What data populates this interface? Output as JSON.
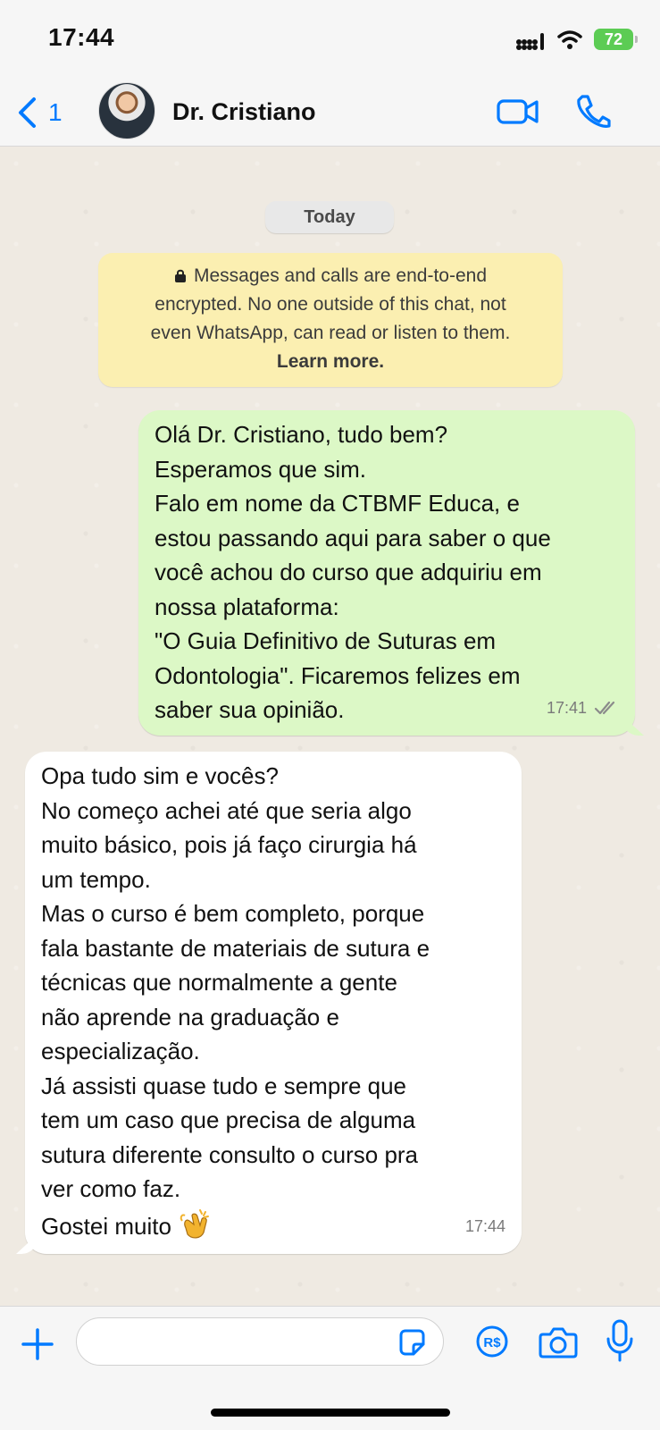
{
  "status_bar": {
    "time": "17:44",
    "battery": "72",
    "icons": [
      "signal-icon",
      "wifi-icon",
      "battery-icon"
    ]
  },
  "header": {
    "back_count": "1",
    "contact_name": "Dr. Cristiano",
    "icons": [
      "back-chevron-icon",
      "video-call-icon",
      "phone-call-icon"
    ]
  },
  "chat": {
    "date_label": "Today",
    "encryption_notice": {
      "lines": [
        "Messages and calls are end-to-end",
        "encrypted. No one outside of this chat, not",
        "even WhatsApp, can read or listen to them."
      ],
      "link": "Learn more."
    },
    "messages": [
      {
        "direction": "outgoing",
        "lines": [
          "Olá Dr. Cristiano, tudo bem?",
          "Esperamos que sim.",
          "Falo em nome da CTBMF Educa, e",
          "estou passando aqui para saber o que",
          "você achou do curso que adquiriu em",
          "nossa plataforma:",
          "\"O Guia Definitivo de Suturas em",
          "Odontologia\". Ficaremos felizes em",
          "saber sua opinião."
        ],
        "time": "17:41",
        "status_icon": "double-check-icon"
      },
      {
        "direction": "incoming",
        "lines": [
          "Opa tudo sim e vocês?",
          "No começo achei até que seria algo",
          "muito básico, pois já faço cirurgia há",
          "um tempo.",
          "Mas o curso é bem completo, porque",
          "fala bastante de materiais de sutura e",
          "técnicas que normalmente a gente",
          "não aprende na graduação e",
          "especialização.",
          "Já assisti quase tudo e sempre que",
          "tem um caso que precisa de alguma",
          "sutura diferente consulto o curso pra",
          "ver como faz.",
          "Gostei muito"
        ],
        "emoji": "clapping-hands-icon",
        "time": "17:44"
      }
    ]
  },
  "input_bar": {
    "placeholder": "",
    "pay_label": "R$",
    "icons": [
      "plus-icon",
      "sticker-icon",
      "payment-icon",
      "camera-icon",
      "microphone-icon"
    ]
  },
  "colors": {
    "accent": "#007aff",
    "outgoing_bubble": "#dcf8c6",
    "incoming_bubble": "#ffffff",
    "notice": "#fbefb1",
    "background": "#efeae2"
  }
}
